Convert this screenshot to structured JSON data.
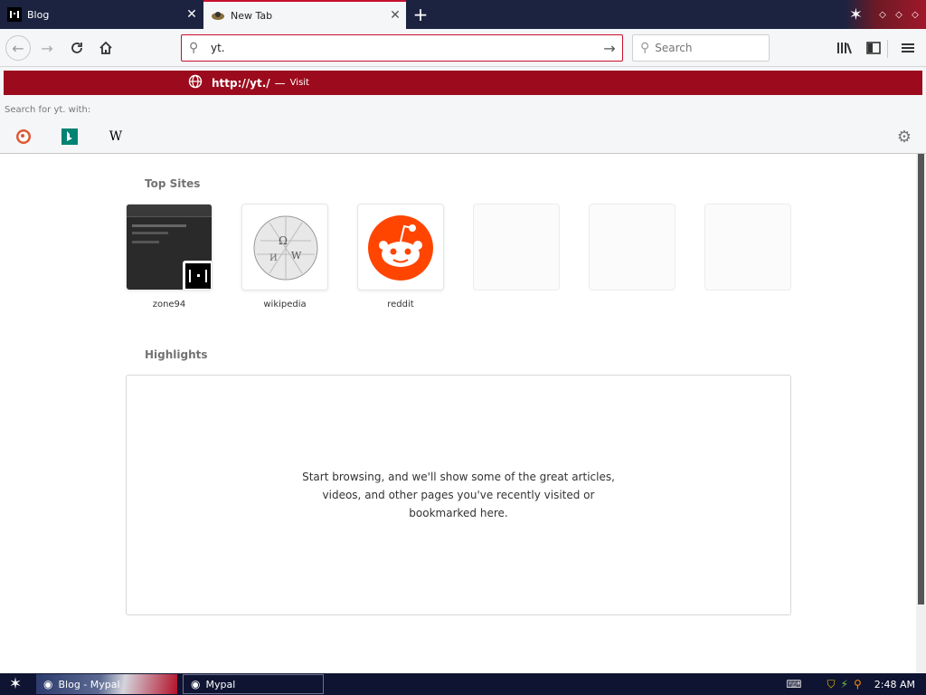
{
  "tabs": [
    {
      "title": "Blog",
      "active": false
    },
    {
      "title": "New Tab",
      "active": true
    }
  ],
  "navbar": {
    "url_value": "yt.",
    "search_placeholder": "Search"
  },
  "dropdown": {
    "suggestion_url": "http://yt./",
    "suggestion_dash": "—",
    "suggestion_action": "Visit",
    "search_for": "Search for yt. with:",
    "engines": [
      {
        "name": "DuckDuckGo",
        "icon": "duckduckgo-icon"
      },
      {
        "name": "Bing",
        "icon": "bing-icon"
      },
      {
        "name": "Wikipedia",
        "icon": "wikipedia-icon"
      }
    ]
  },
  "content": {
    "topsites_title": "Top Sites",
    "sites": [
      {
        "label": "zone94"
      },
      {
        "label": "wikipedia"
      },
      {
        "label": "reddit"
      },
      {
        "label": ""
      },
      {
        "label": ""
      },
      {
        "label": ""
      }
    ],
    "highlights_title": "Highlights",
    "highlights_message": "Start browsing, and we'll show some of the great articles, videos, and other pages you've recently visited or bookmarked here."
  },
  "taskbar": {
    "tasks": [
      {
        "label": "Blog - Mypal"
      },
      {
        "label": "Mypal"
      }
    ],
    "clock": "2:48 AM"
  },
  "colors": {
    "accent": "#c8102e",
    "suggestion_bg": "#9c0b1d",
    "tabstrip_bg": "#1c2340",
    "reddit": "#ff4500"
  }
}
